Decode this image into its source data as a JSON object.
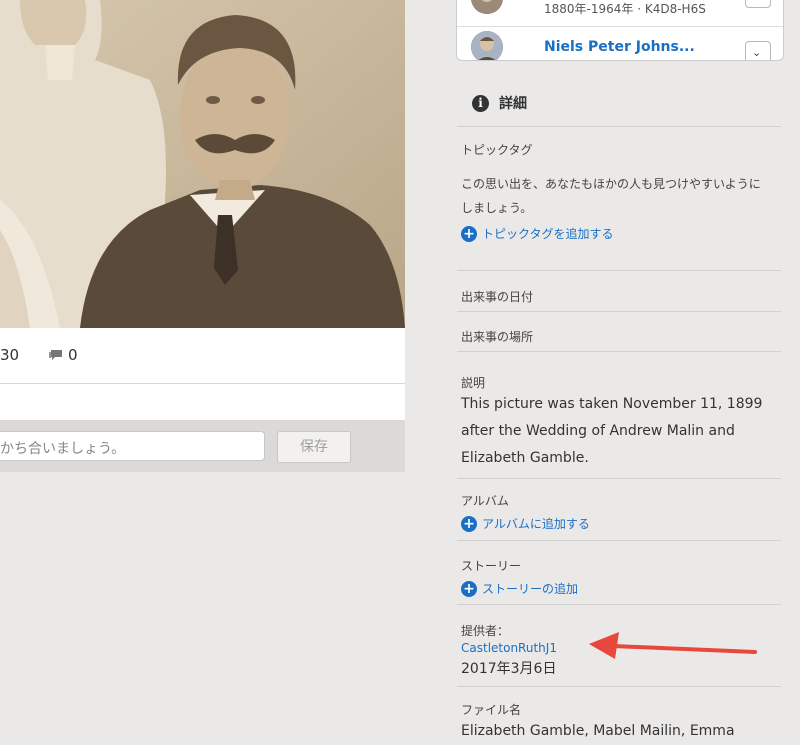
{
  "photo": {
    "alt": "Sepia family portrait"
  },
  "stats": {
    "views": "30",
    "comments": "0"
  },
  "comment_box": {
    "placeholder": "かち合いましょう。",
    "save_label": "保存"
  },
  "people": [
    {
      "dates": "1880年-1964年 · K4D8-H6S"
    },
    {
      "name": "Niels Peter Johns..."
    }
  ],
  "details": {
    "title": "詳細",
    "topic_tags": {
      "label": "トピックタグ",
      "description": "この思い出を、あなたもほかの人も見つけやすいようにしましょう。",
      "add_label": "トピックタグを追加する"
    },
    "event_date_label": "出来事の日付",
    "event_place_label": "出来事の場所",
    "description": {
      "label": "説明",
      "text": "This picture was taken November 11, 1899 after the Wedding of Andrew Malin and Elizabeth Gamble."
    },
    "album": {
      "label": "アルバム",
      "add_label": "アルバムに追加する"
    },
    "story": {
      "label": "ストーリー",
      "add_label": "ストーリーの追加"
    },
    "contributor": {
      "label": "提供者：",
      "name": "CastletonRuthJ1",
      "date": "2017年3月6日"
    },
    "filename": {
      "label": "ファイル名",
      "text": "Elizabeth Gamble, Mabel Mailin, Emma"
    }
  },
  "colors": {
    "link": "#1a6fc4",
    "arrow": "#e8473e",
    "background": "#ebe9e7"
  }
}
